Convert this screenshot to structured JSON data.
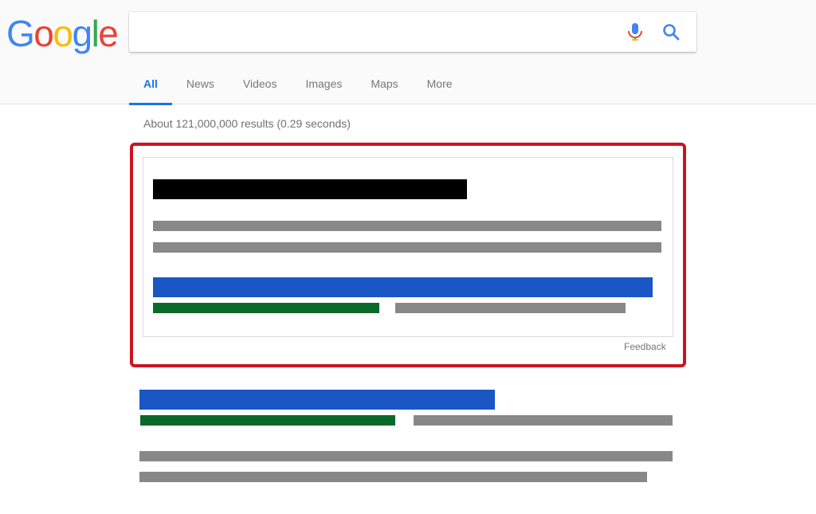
{
  "logo": {
    "letters": [
      "G",
      "o",
      "o",
      "g",
      "l",
      "e"
    ],
    "colors": [
      "#4285f4",
      "#ea4335",
      "#fbbc05",
      "#4285f4",
      "#34a853",
      "#ea4335"
    ]
  },
  "search": {
    "value": "",
    "icons": {
      "voice": "microphone-icon",
      "submit": "search-icon"
    }
  },
  "tabs": [
    {
      "label": "All",
      "active": true
    },
    {
      "label": "News"
    },
    {
      "label": "Videos"
    },
    {
      "label": "Images"
    },
    {
      "label": "Maps"
    },
    {
      "label": "More"
    }
  ],
  "result_stats": "About 121,000,000 results (0.29 seconds)",
  "featured_snippet": {
    "feedback_label": "Feedback",
    "highlight_color": "#cc1420"
  },
  "colors": {
    "redacted_title": "#000000",
    "redacted_text": "#888888",
    "redacted_link": "#1a56c4",
    "redacted_url": "#0a6a2a",
    "accent": "#1a73e8"
  }
}
